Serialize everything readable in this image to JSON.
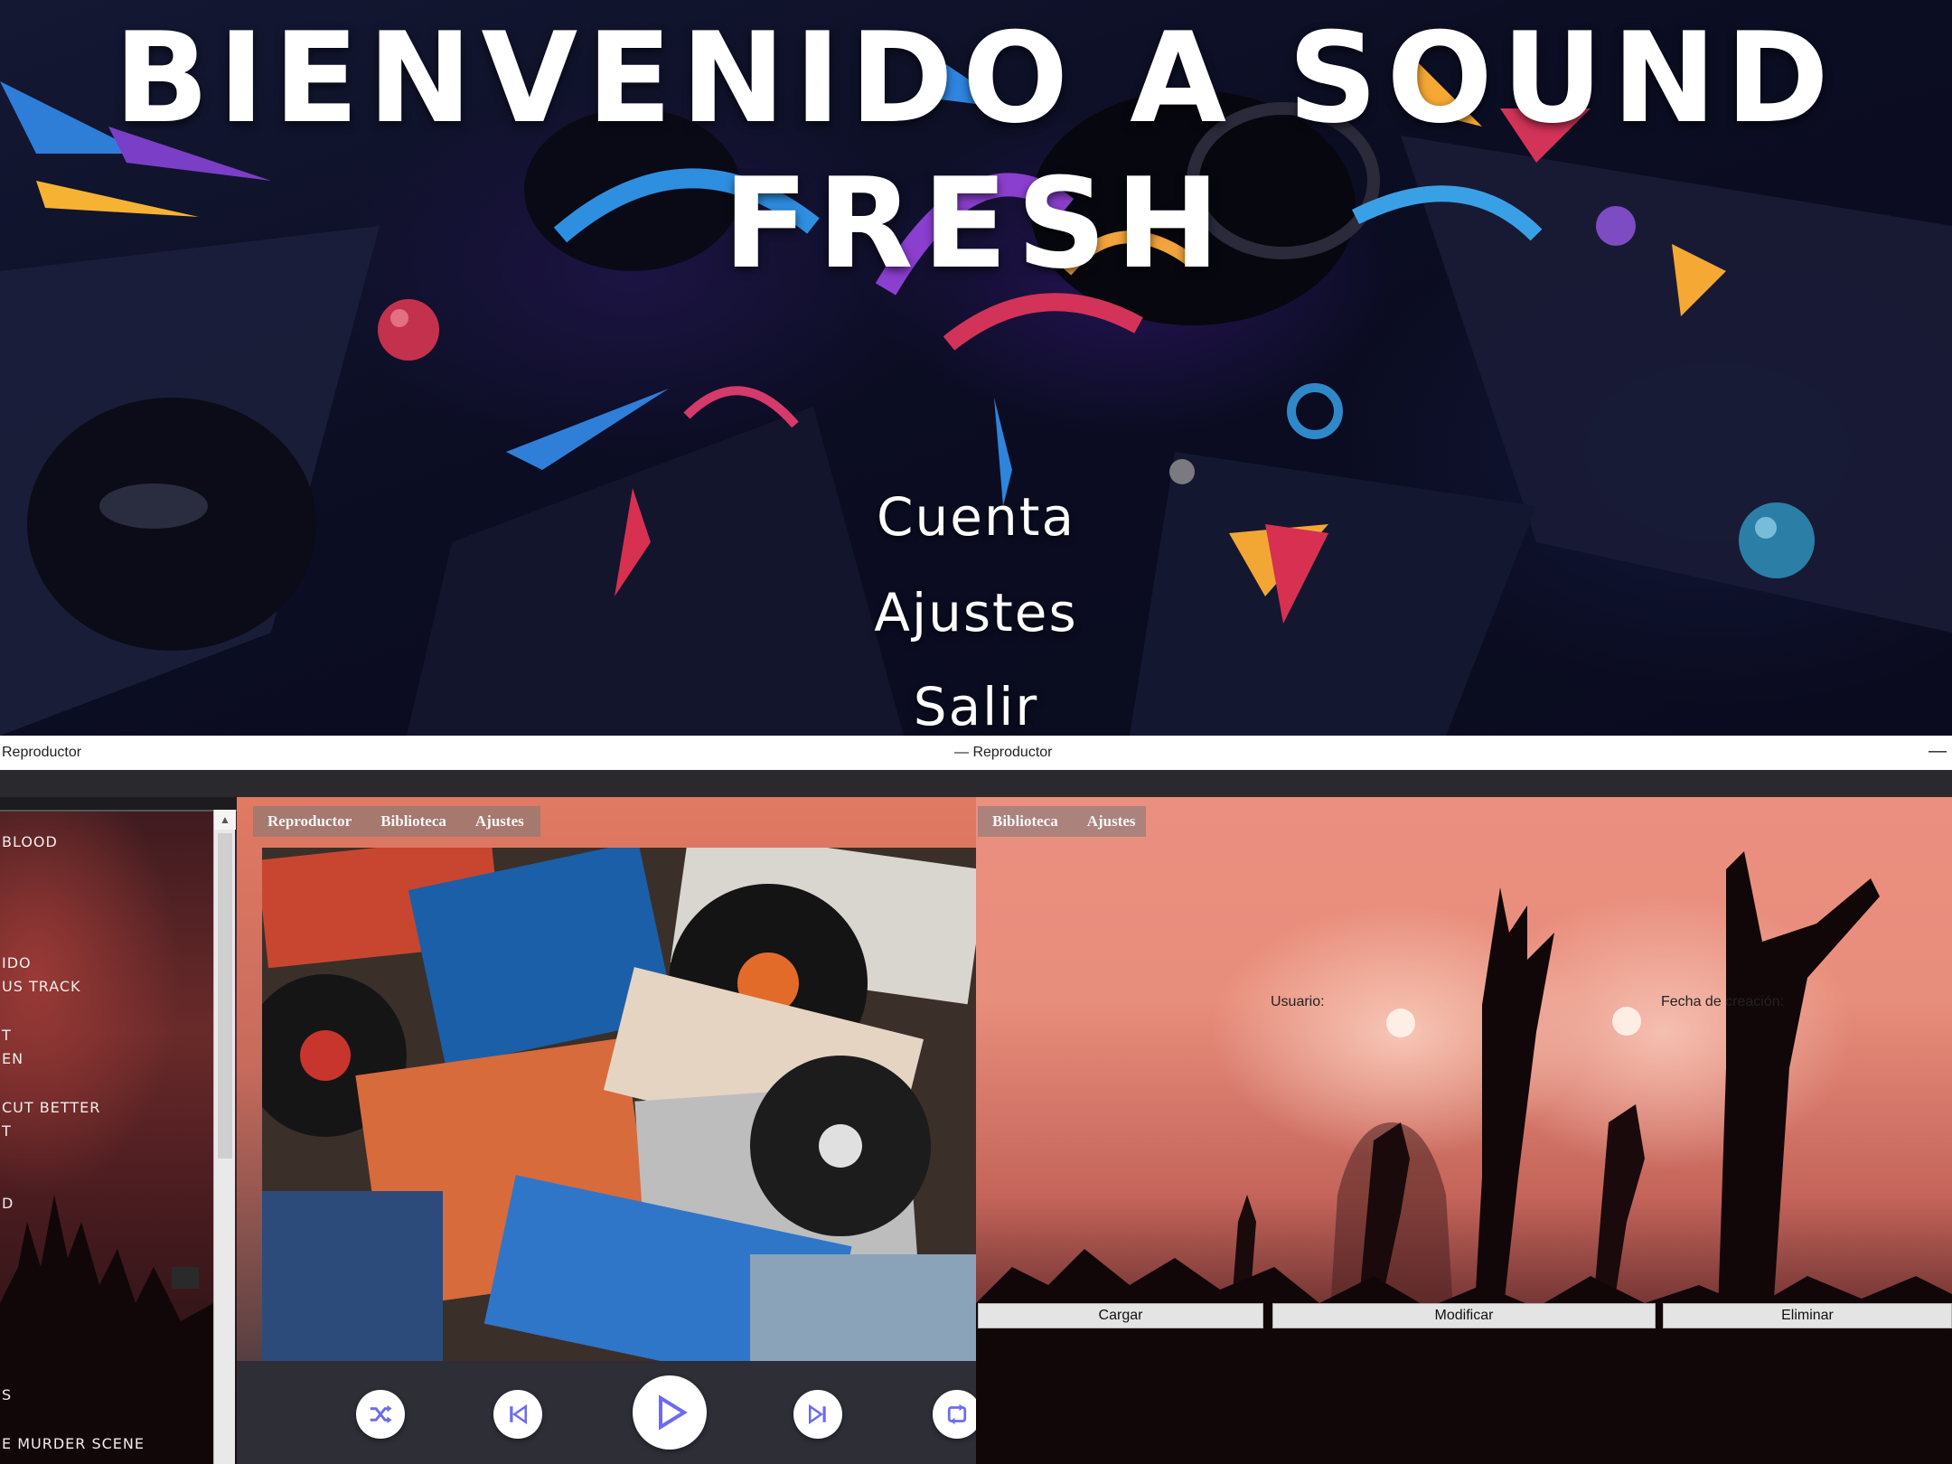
{
  "hero": {
    "title": "Bienvenido a Sound Fresh",
    "menu": [
      "Cuenta",
      "Ajustes",
      "Salir"
    ]
  },
  "titlebar": {
    "left_title": "Reproductor",
    "center_title": "— Reproductor",
    "minimize": "—"
  },
  "song_list": {
    "items": [
      "BLOOD",
      "IDO",
      "US TRACK",
      "T",
      "EN",
      "CUT BETTER",
      "T",
      "D",
      "S",
      "E MURDER SCENE"
    ]
  },
  "player": {
    "tabs": [
      "Reproductor",
      "Biblioteca",
      "Ajustes"
    ],
    "controls": [
      {
        "name": "shuffle",
        "icon": "shuffle-icon"
      },
      {
        "name": "previous",
        "icon": "skip-back-icon"
      },
      {
        "name": "play",
        "icon": "play-icon"
      },
      {
        "name": "next",
        "icon": "skip-forward-icon"
      },
      {
        "name": "repeat",
        "icon": "repeat-icon"
      }
    ],
    "accent_color": "#6b6bf2"
  },
  "library": {
    "tabs": [
      "Biblioteca",
      "Ajustes"
    ],
    "user_label": "Usuario:",
    "date_label": "Fecha de creación:",
    "buttons": {
      "load": "Cargar",
      "modify": "Modificar",
      "delete": "Eliminar"
    }
  }
}
